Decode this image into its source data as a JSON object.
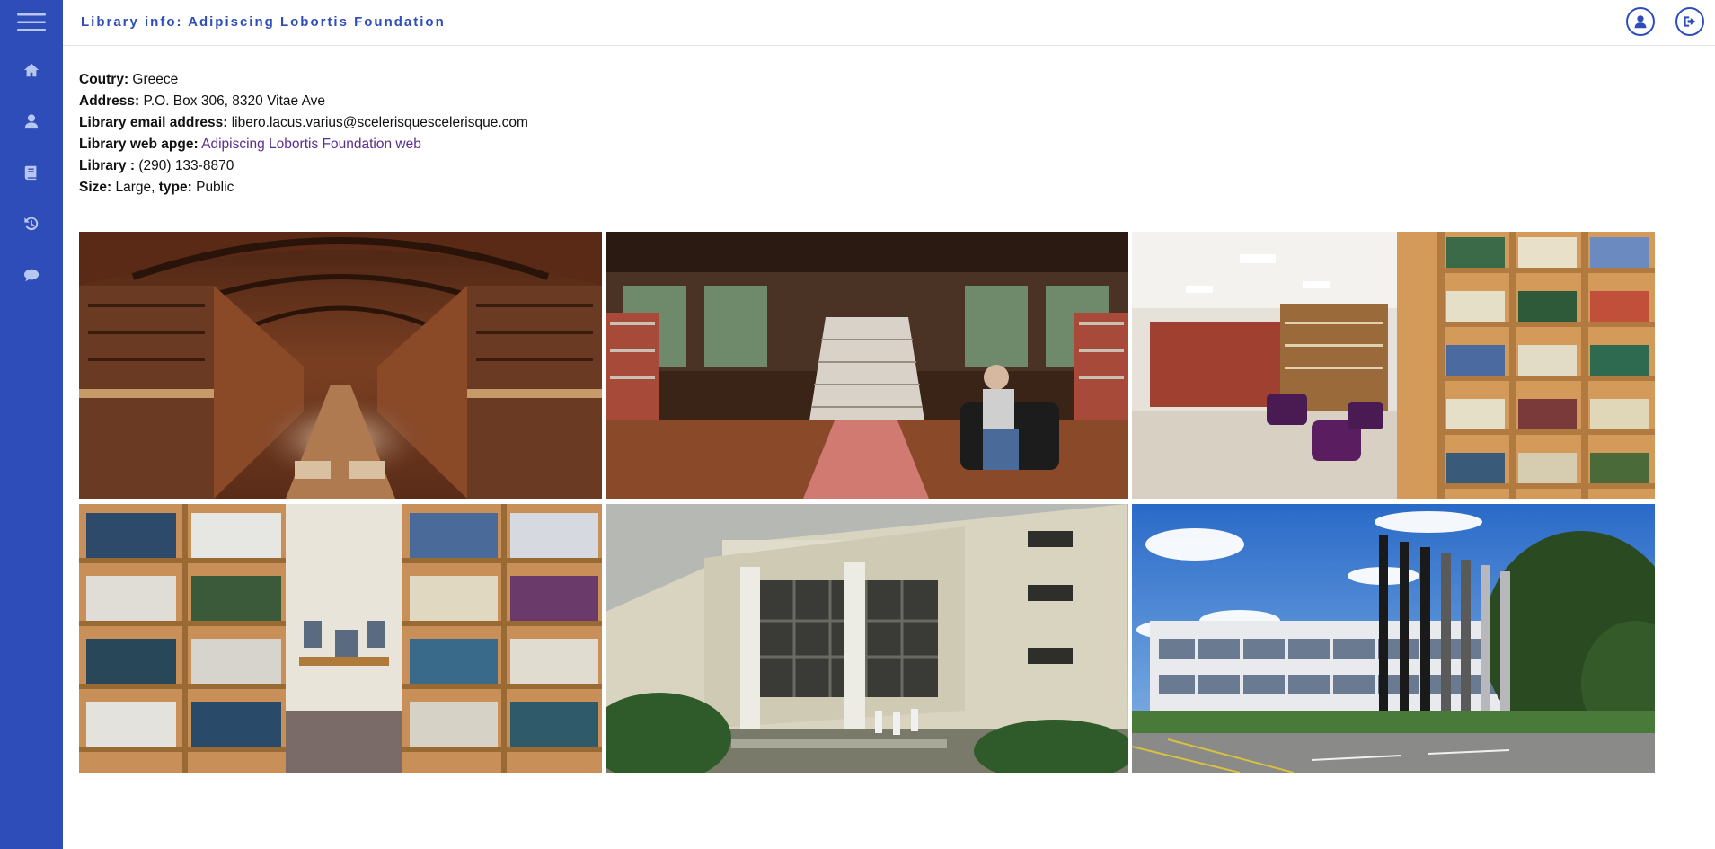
{
  "header": {
    "title": "Library info: Adipiscing Lobortis Foundation"
  },
  "sidebar": {
    "items": [
      {
        "icon": "home-icon"
      },
      {
        "icon": "user-icon"
      },
      {
        "icon": "book-icon"
      },
      {
        "icon": "history-icon"
      },
      {
        "icon": "chat-icon"
      }
    ]
  },
  "topbar_actions": [
    {
      "icon": "profile-icon"
    },
    {
      "icon": "logout-icon"
    }
  ],
  "info": {
    "country_label": "Coutry:",
    "country_value": " Greece",
    "address_label": "Address:",
    "address_value": " P.O. Box 306, 8320 Vitae Ave",
    "email_label": "Library email address:",
    "email_value": " libero.lacus.varius@scelerisquescelerisque.com",
    "web_label": "Library web apge:",
    "web_link": "Adipiscing Lobortis Foundation web",
    "phone_label": "Library :",
    "phone_value": " (290) 133-8870",
    "size_label": "Size:",
    "size_value": " Large,",
    "type_label": " type:",
    "type_value": " Public"
  },
  "colors": {
    "accent": "#2f4db8",
    "sidebar_icon": "#b8c6f2",
    "link": "#5b2d8e"
  }
}
